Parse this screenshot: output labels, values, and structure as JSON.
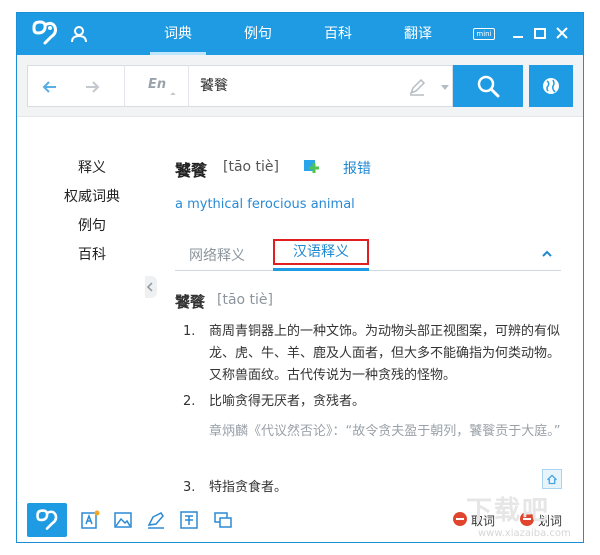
{
  "titlebar": {
    "tabs": [
      {
        "label": "词典",
        "active": true
      },
      {
        "label": "例句",
        "active": false
      },
      {
        "label": "百科",
        "active": false
      },
      {
        "label": "翻译",
        "active": false
      }
    ],
    "mini_label": "mini",
    "colors": {
      "accent": "#1e9be2"
    }
  },
  "search": {
    "language": "En",
    "query": "饕餮"
  },
  "sidenav": {
    "items": [
      "释义",
      "权威词典",
      "例句",
      "百科"
    ]
  },
  "entry": {
    "headword": "饕餮",
    "pinyin": "[tāo tiè]",
    "report_label": "报错",
    "english": "a mythical ferocious animal"
  },
  "tabs": {
    "web": "网络释义",
    "chinese": "汉语释义"
  },
  "chinese_def": {
    "headword": "饕餮",
    "pinyin": "[tāo tiè]",
    "items": [
      {
        "num": "1.",
        "text": "商周青铜器上的一种文饰。为动物头部正视图案，可辨的有似龙、虎、牛、羊、鹿及人面者，但大多不能确指为何类动物。又称兽面纹。古代传说为一种贪残的怪物。"
      },
      {
        "num": "2.",
        "text": "比喻贪得无厌者，贪残者。",
        "example": "章炳麟《代议然否论》：“故令贪夫盈于朝列，饕餮贡于大庭。”"
      },
      {
        "num": "3.",
        "text": "特指贪食者。"
      }
    ]
  },
  "bottombar": {
    "take_word": "取词",
    "select_word": "划词"
  },
  "watermark": {
    "main": "下载吧",
    "sub": "www.xiazaiba.com"
  }
}
